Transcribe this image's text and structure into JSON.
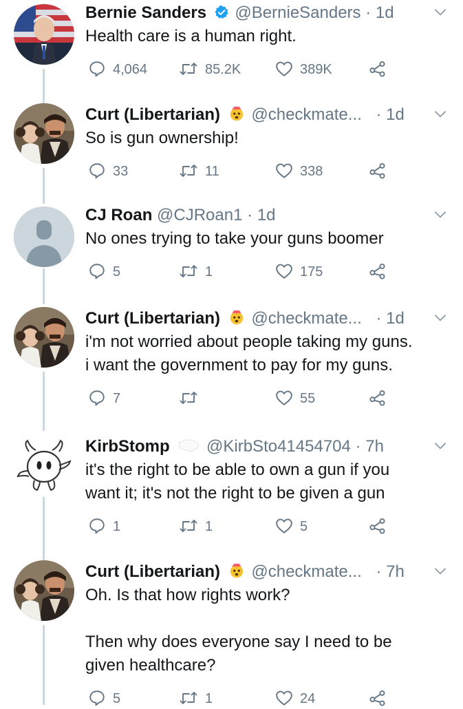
{
  "colors": {
    "text": "#14171a",
    "muted": "#657786",
    "verified": "#1da1f2",
    "line": "#ccd6dd"
  },
  "tweets": [
    {
      "name": "Bernie Sanders",
      "verified_icon": "verified-badge-icon",
      "handle": "@BernieSanders",
      "dot": "·",
      "time": "1d",
      "lines": [
        "Health care is a human right."
      ],
      "replies": "4,064",
      "retweets": "85.2K",
      "likes": "389K"
    },
    {
      "name": "Curt (Libertarian)",
      "emoji_icon": "exploding-head-emoji",
      "handle": "@checkmate...",
      "dot": "·",
      "time": "1d",
      "lines": [
        "So is gun ownership!"
      ],
      "replies": "33",
      "retweets": "11",
      "likes": "338"
    },
    {
      "name": "CJ Roan",
      "handle": "@CJRoan1",
      "dot": "·",
      "time": "1d",
      "lines": [
        "No ones trying to take your guns boomer"
      ],
      "replies": "5",
      "retweets": "1",
      "likes": "175"
    },
    {
      "name": "Curt (Libertarian)",
      "emoji_icon": "exploding-head-emoji",
      "handle": "@checkmate...",
      "dot": "·",
      "time": "1d",
      "lines": [
        "i'm not worried about people taking my guns.",
        "i want the government to pay for my guns."
      ],
      "replies": "7",
      "retweets": "",
      "likes": "55"
    },
    {
      "name": "KirbStomp",
      "emoji_icon": "speech-bubble-icon",
      "handle": "@KirbSto41454704",
      "dot": "·",
      "time": "7h",
      "lines": [
        "it's the right to be able to own a gun if you",
        "want it; it's not the right to be given a gun"
      ],
      "replies": "1",
      "retweets": "1",
      "likes": "5"
    },
    {
      "name": "Curt (Libertarian)",
      "emoji_icon": "exploding-head-emoji",
      "handle": "@checkmate...",
      "dot": "·",
      "time": "7h",
      "lines": [
        "Oh. Is that how rights work?",
        "",
        "Then why does everyone say I need to be",
        "given healthcare?"
      ],
      "replies": "5",
      "retweets": "1",
      "likes": "24"
    }
  ]
}
